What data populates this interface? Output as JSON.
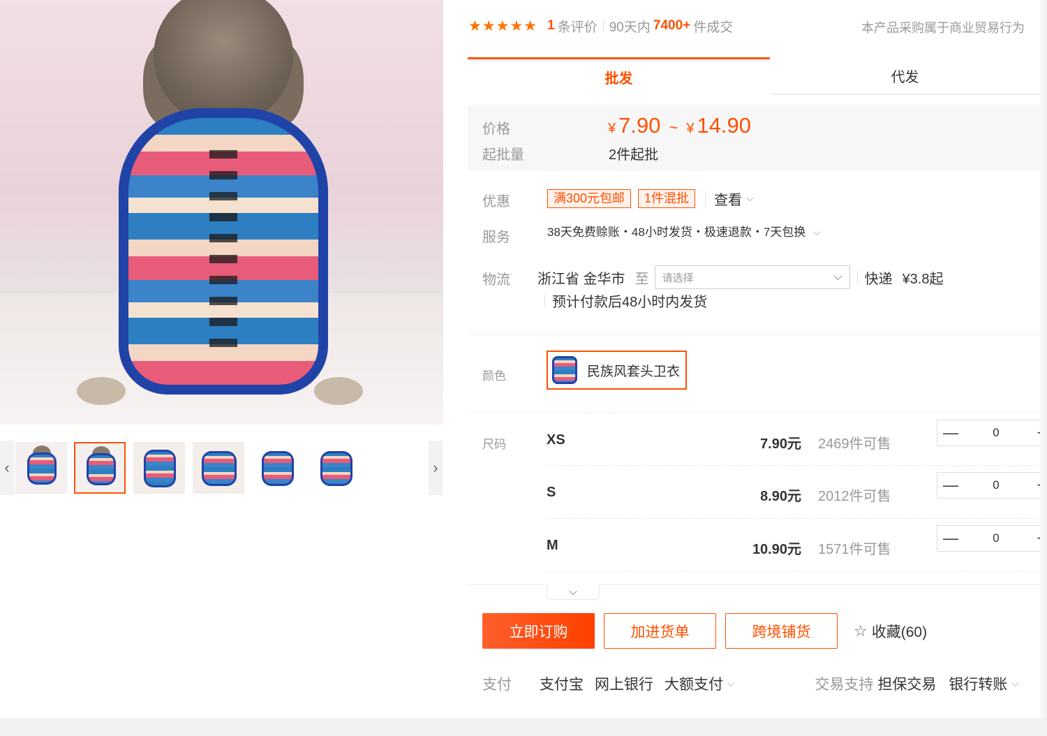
{
  "product": {
    "rating": {
      "stars": "★★★★★",
      "count": "1",
      "count_suffix": "条评价",
      "sold_prefix": "90天内",
      "sold_num": "7400+",
      "sold_suffix": "件成交"
    },
    "trade_note": "本产品采购属于商业贸易行为"
  },
  "tabs": [
    {
      "label": "批发",
      "active": true
    },
    {
      "label": "代发",
      "active": false
    }
  ],
  "price": {
    "label": "价格",
    "currency": "¥",
    "low": "7.90",
    "tilde": "~",
    "high": "14.90",
    "moq_label": "起批量",
    "moq_value": "2件起批"
  },
  "promo": {
    "label": "优惠",
    "tags": [
      "满300元包邮",
      "1件混批"
    ],
    "view_label": "查看"
  },
  "service": {
    "label": "服务",
    "text": "38天免费赊账・48小时发货・极速退款・7天包换"
  },
  "logistics": {
    "label": "物流",
    "origin": "浙江省 金华市",
    "to": "至",
    "select_placeholder": "请选择",
    "method": "快递",
    "fee": "¥3.8起",
    "eta": "预计付款后48小时内发货"
  },
  "color": {
    "label": "颜色",
    "option": "民族风套头卫衣"
  },
  "sizes": {
    "label": "尺码",
    "rows": [
      {
        "name": "XS",
        "price": "7.90元",
        "stock": "2469件可售",
        "qty": "0"
      },
      {
        "name": "S",
        "price": "8.90元",
        "stock": "2012件可售",
        "qty": "0"
      },
      {
        "name": "M",
        "price": "10.90元",
        "stock": "1571件可售",
        "qty": "0"
      }
    ],
    "minus": "—",
    "plus": "+"
  },
  "actions": {
    "buy": "立即订购",
    "cart": "加进货单",
    "cross_border": "跨境铺货",
    "favorite": "收藏(60)"
  },
  "payment": {
    "label": "支付",
    "methods": [
      "支付宝",
      "网上银行",
      "大额支付"
    ],
    "support_label": "交易支持",
    "support_items": [
      "担保交易",
      "银行转账"
    ]
  },
  "icons": {
    "star": "star-icon",
    "chevron": "chevron-down-icon",
    "prev": "chevron-left-icon",
    "next": "chevron-right-icon"
  },
  "colors": {
    "accent": "#ff5000",
    "muted": "#999999",
    "border": "#eeeeee"
  }
}
